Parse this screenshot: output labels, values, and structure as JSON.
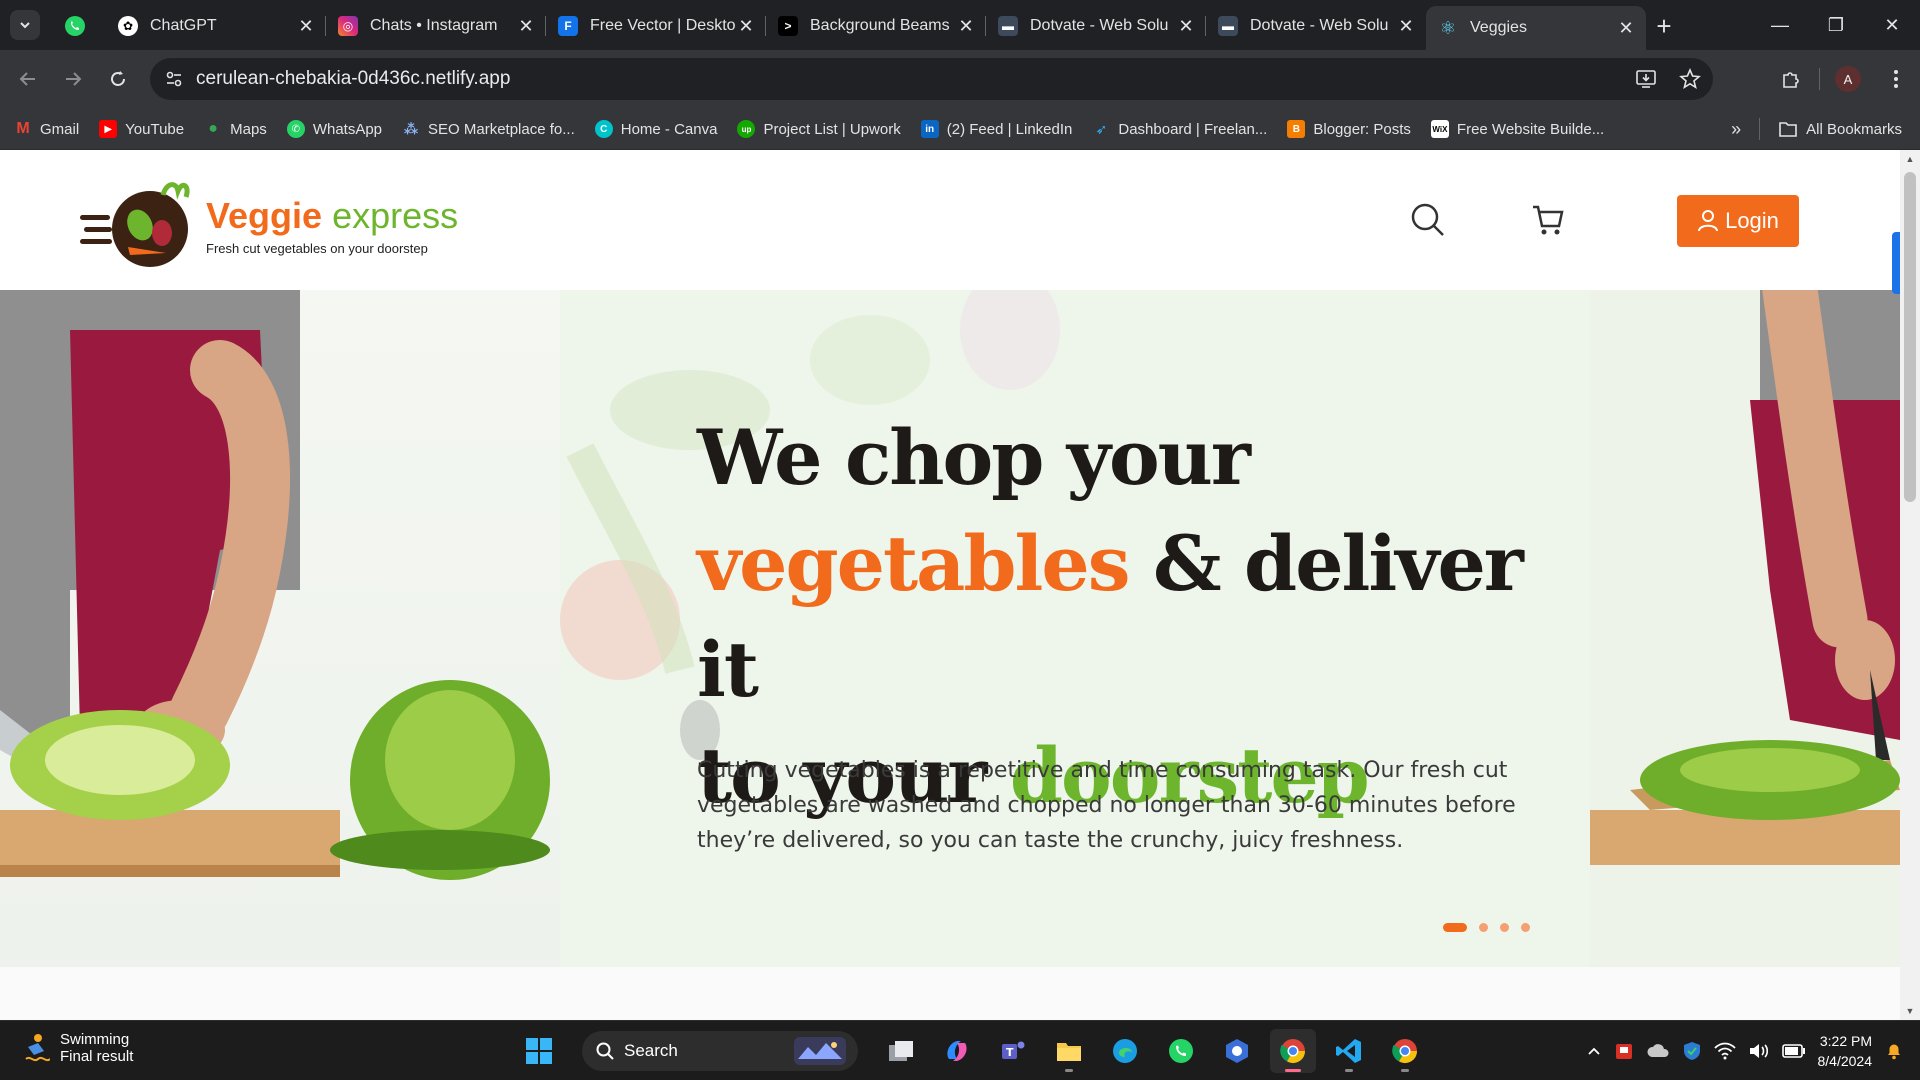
{
  "browser": {
    "pinned_tab": "WhatsApp",
    "tabs": [
      {
        "title": "ChatGPT",
        "icon": "chatgpt-icon",
        "active": false
      },
      {
        "title": "Chats • Instagram",
        "icon": "instagram-icon",
        "active": false
      },
      {
        "title": "Free Vector | Deskto",
        "icon": "freepik-icon",
        "active": false
      },
      {
        "title": "Background Beams",
        "icon": "terminal-icon",
        "active": false
      },
      {
        "title": "Dotvate - Web Solu",
        "icon": "dotvate-icon",
        "active": false
      },
      {
        "title": "Dotvate - Web Solu",
        "icon": "dotvate-icon",
        "active": false
      },
      {
        "title": "Veggies",
        "icon": "react-icon",
        "active": true
      }
    ],
    "url": "cerulean-chebakia-0d436c.netlify.app",
    "profile_initial": "A",
    "bookmarks": [
      {
        "label": "Gmail",
        "color": "#ea4335"
      },
      {
        "label": "YouTube",
        "color": "#ff0000"
      },
      {
        "label": "Maps",
        "color": "#34a853"
      },
      {
        "label": "WhatsApp",
        "color": "#25d366"
      },
      {
        "label": "SEO Marketplace fo...",
        "color": "#8ab4f8"
      },
      {
        "label": "Home - Canva",
        "color": "#00c4cc"
      },
      {
        "label": "Project List | Upwork",
        "color": "#14a800"
      },
      {
        "label": "(2) Feed | LinkedIn",
        "color": "#0a66c2"
      },
      {
        "label": "Dashboard | Freelan...",
        "color": "#29b2fe"
      },
      {
        "label": "Blogger: Posts",
        "color": "#f57d00"
      },
      {
        "label": "Free Website Builde...",
        "color": "#ffffff"
      }
    ],
    "all_bookmarks": "All Bookmarks"
  },
  "site": {
    "brand_part1": "Veggie",
    "brand_part2": "express",
    "tagline": "Fresh cut vegetables on your doorstep",
    "login_label": "Login",
    "hero": {
      "line1": "We chop your",
      "line2_orange": "vegetables",
      "line2_dark": " & deliver it",
      "line3_dark": "to your ",
      "line3_green": "doorstep",
      "paragraph": "Cutting vegetables is a repetitive and time consuming task. Our fresh cut vegetables are washed and chopped no longer than 30-60 minutes before they’re delivered, so you can taste the crunchy, juicy freshness."
    },
    "slider": {
      "total": 4,
      "active": 1
    },
    "colors": {
      "orange": "#f26b1d",
      "green": "#6cb52d",
      "dark": "#1d1a17"
    }
  },
  "taskbar": {
    "weather_title": "Swimming",
    "weather_sub": "Final result",
    "search_placeholder": "Search",
    "time": "3:22 PM",
    "date": "8/4/2024"
  }
}
